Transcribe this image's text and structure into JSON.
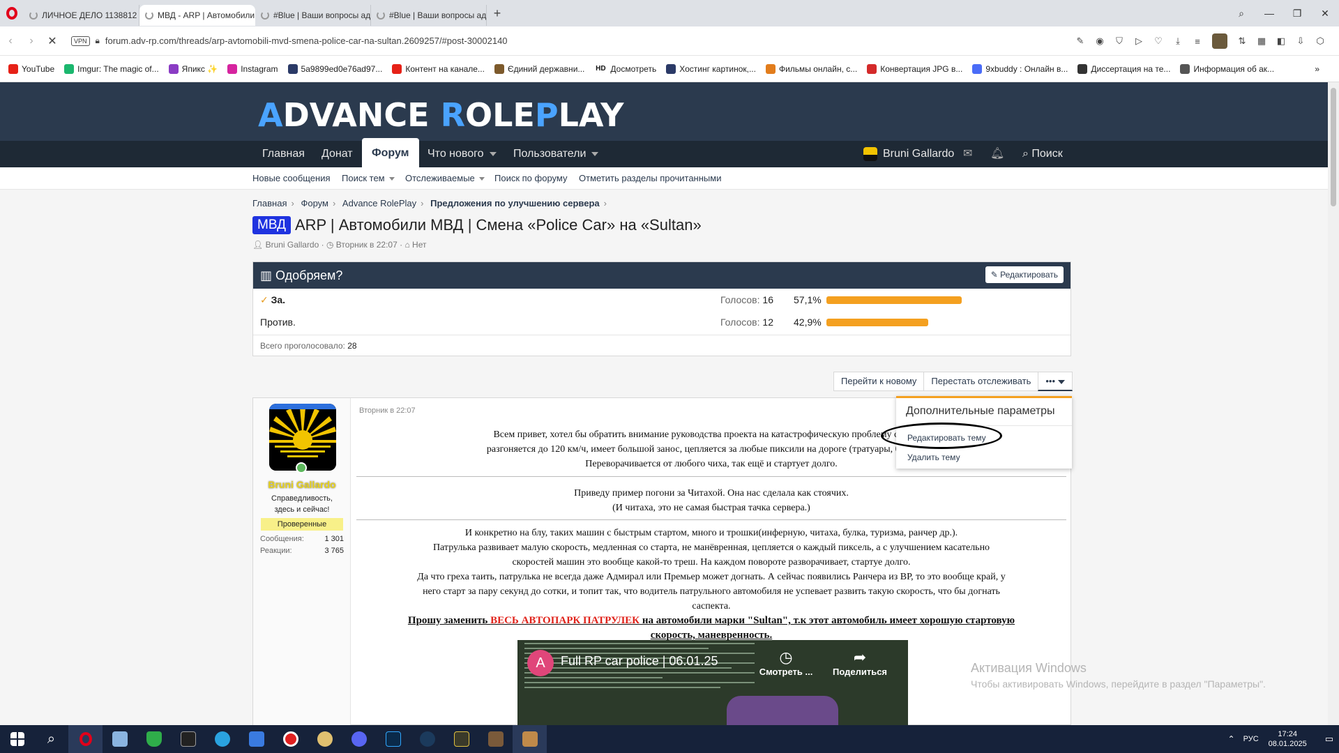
{
  "browser": {
    "tabs": [
      {
        "label": "ЛИЧНОЕ ДЕЛО 1138812"
      },
      {
        "label": "МВД - ARP | Автомобили"
      },
      {
        "label": "#Blue | Ваши вопросы ад"
      },
      {
        "label": "#Blue | Ваши вопросы ад"
      }
    ],
    "new_tab": "+",
    "vpn": "VPN",
    "url": "forum.adv-rp.com/threads/arp-avtomobili-mvd-smena-police-car-na-sultan.2609257/#post-30002140",
    "bookmarks": [
      {
        "label": "YouTube",
        "color": "#e62117"
      },
      {
        "label": "Imgur: The magic of...",
        "color": "#1bb76e"
      },
      {
        "label": "Япикс ✨",
        "color": "#8a3cc4"
      },
      {
        "label": "Instagram",
        "color": "#d6249f"
      },
      {
        "label": "5a9899ed0e76ad97...",
        "color": "#2b3a67"
      },
      {
        "label": "Контент на канале...",
        "color": "#e62117"
      },
      {
        "label": "Єдиний державни...",
        "color": "#7d5a2c"
      },
      {
        "label": "Досмотреть",
        "color": "#222222",
        "prefix": "HD"
      },
      {
        "label": "Хостинг картинок,...",
        "color": "#2b3a67"
      },
      {
        "label": "Фильмы онлайн, с...",
        "color": "#e27d1c"
      },
      {
        "label": "Конвертация JPG в...",
        "color": "#d42a2a"
      },
      {
        "label": "9xbuddy : Онлайн в...",
        "color": "#4a6cf7"
      },
      {
        "label": "Диссертация на те...",
        "color": "#333333"
      },
      {
        "label": "Информация об ак...",
        "color": "#555555"
      }
    ]
  },
  "site": {
    "logo_parts": [
      "A",
      "DVANCE ",
      "R",
      "OLE",
      "P",
      "LAY"
    ],
    "nav": [
      {
        "label": "Главная"
      },
      {
        "label": "Донат"
      },
      {
        "label": "Форум"
      },
      {
        "label": "Что нового"
      },
      {
        "label": "Пользователи"
      }
    ],
    "user": "Bruni Gallardo",
    "search": "Поиск",
    "subnav": [
      {
        "label": "Новые сообщения"
      },
      {
        "label": "Поиск тем"
      },
      {
        "label": "Отслеживаемые"
      },
      {
        "label": "Поиск по форуму"
      },
      {
        "label": "Отметить разделы прочитанными"
      }
    ]
  },
  "breadcrumbs": [
    "Главная",
    "Форум",
    "Advance RolePlay",
    "Предложения по улучшению сервера"
  ],
  "thread": {
    "prefix": "МВД",
    "title": "ARP | Автомобили МВД | Смена «Police Car» на «Sultan»",
    "author": "Bruni Gallardo",
    "date": "Вторник в 22:07",
    "tags": "Нет"
  },
  "poll": {
    "title": "Одобряем?",
    "edit": "Редактировать",
    "votes_label": "Голосов:",
    "options": [
      {
        "label": "За.",
        "votes": "16",
        "percent": "57,1%",
        "share": 0.571
      },
      {
        "label": "Против.",
        "votes": "12",
        "percent": "42,9%",
        "share": 0.429
      }
    ],
    "total_label": "Всего проголосовало:",
    "total": "28"
  },
  "actions": {
    "goto_new": "Перейти к новому",
    "unwatch": "Перестать отслеживать",
    "more": "•••"
  },
  "dropdown": {
    "title": "Дополнительные параметры",
    "items": [
      "Редактировать тему",
      "Удалить тему"
    ]
  },
  "post": {
    "date": "Вторник в 22:07",
    "username": "Bruni Gallardo",
    "user_title_1": "Справедливость,",
    "user_title_2": "здесь и сейчас!",
    "badge": "Проверенные",
    "stats": [
      {
        "label": "Сообщения:",
        "value": "1 301"
      },
      {
        "label": "Реакции:",
        "value": "3 765"
      }
    ],
    "p1": [
      "Всем привет, хотел бы обратить внимание руководства проекта на катастрофическую проблему с машин",
      "разгоняется до 120 км/ч, имеет большой занос, цепляется за любые пиксили на дороге (тратуары, бордюры,",
      "Переворачивается от любого чиха, так ещё и стартует долго."
    ],
    "p2": [
      "Приведу пример погони за Читахой. Она нас сделала как стоячих.",
      "(И читаха, это не самая быстрая тачка сервера.)"
    ],
    "p3": [
      "И конкретно на блу, таких машин с быстрым стартом, много и трошки(инферную, читаха, булка, туризма, ранчер др.).",
      "Патрулька развивает малую скорость, медленная со старта, не манёвренная, цепляется о каждый пиксель, а с улучшением касательно",
      "скоростей машин это вообще какой-то треш. На каждом повороте разворачивает, стартуе долго.",
      "Да что греха таить, патрулька не всегда даже Адмирал или Премьер может догнать. А сейчас появились Ранчера из ВР, то это вообще край, у",
      "него старт за пару секунд до сотки, и топит так, что водитель патрульного автомобиля не успевает развить такую скорость, что бы догнать",
      "саспекта."
    ],
    "ask_1": "Прошу заменить ",
    "ask_red": "ВЕСЬ АВТОПАРК ПАТРУЛЕК",
    "ask_2": " на автомобили марки \"Sultan\", т.к этот автомобиль имеет хорошую стартовую",
    "ask_3": "скорость, маневренность."
  },
  "video": {
    "channel_letter": "A",
    "title": "Full RP car police | 06.01.25",
    "watch_later": "Смотреть ...",
    "share": "Поделиться"
  },
  "watermark": {
    "line1": "Активация Windows",
    "line2": "Чтобы активировать Windows, перейдите в раздел \"Параметры\"."
  },
  "taskbar": {
    "lang": "РУС",
    "time": "17:24",
    "date": "08.01.2025"
  }
}
